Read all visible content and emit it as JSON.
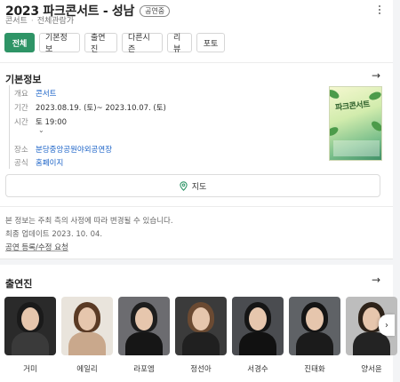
{
  "header": {
    "title": "2023 파크콘서트 - 성남",
    "badge": "공연중",
    "category": "콘서트",
    "age": "전체관람가"
  },
  "tabs": [
    {
      "label": "전체",
      "active": true
    },
    {
      "label": "기본정보",
      "active": false
    },
    {
      "label": "출연진",
      "active": false
    },
    {
      "label": "다른시즌",
      "active": false
    },
    {
      "label": "리뷰",
      "active": false
    },
    {
      "label": "포토",
      "active": false
    }
  ],
  "basic_info": {
    "heading": "기본정보",
    "rows": {
      "overview": {
        "key": "개요",
        "value": "콘서트"
      },
      "period": {
        "key": "기간",
        "value": "2023.08.19. (토)~ 2023.10.07. (토)"
      },
      "time": {
        "key": "시간",
        "value": "토 19:00"
      },
      "place": {
        "key": "장소",
        "value": "분당중앙공원야외공연장"
      },
      "official": {
        "key": "공식",
        "value": "홈페이지"
      }
    },
    "poster_text": "파크콘서트",
    "map_label": "지도",
    "notice": "본 정보는 주최 측의 사정에 따라 변경될 수 있습니다.",
    "updated": "최종 업데이트 2023. 10. 04.",
    "report_link": "공연 등록/수정 요청"
  },
  "cast": {
    "heading": "출연진",
    "members": [
      {
        "name": "거미",
        "bg": "#2a2a2a",
        "hair": "#1a1a1a",
        "body": "#3a3a3a"
      },
      {
        "name": "에일리",
        "bg": "#e9e4dc",
        "hair": "#5a3a24",
        "body": "#c9a88c"
      },
      {
        "name": "라포엠",
        "bg": "#6c6c70",
        "hair": "#1d1d1d",
        "body": "#161616"
      },
      {
        "name": "정선아",
        "bg": "#3b3b3b",
        "hair": "#6b4a32",
        "body": "#202020"
      },
      {
        "name": "서경수",
        "bg": "#4a4c50",
        "hair": "#151515",
        "body": "#111111"
      },
      {
        "name": "진태화",
        "bg": "#5f6266",
        "hair": "#141414",
        "body": "#1b1b1b"
      },
      {
        "name": "양서윤",
        "bg": "#bdbdbd",
        "hair": "#2d2219",
        "body": "#232323"
      }
    ]
  },
  "colors": {
    "accent": "#2e9466",
    "link": "#1a62c7"
  }
}
